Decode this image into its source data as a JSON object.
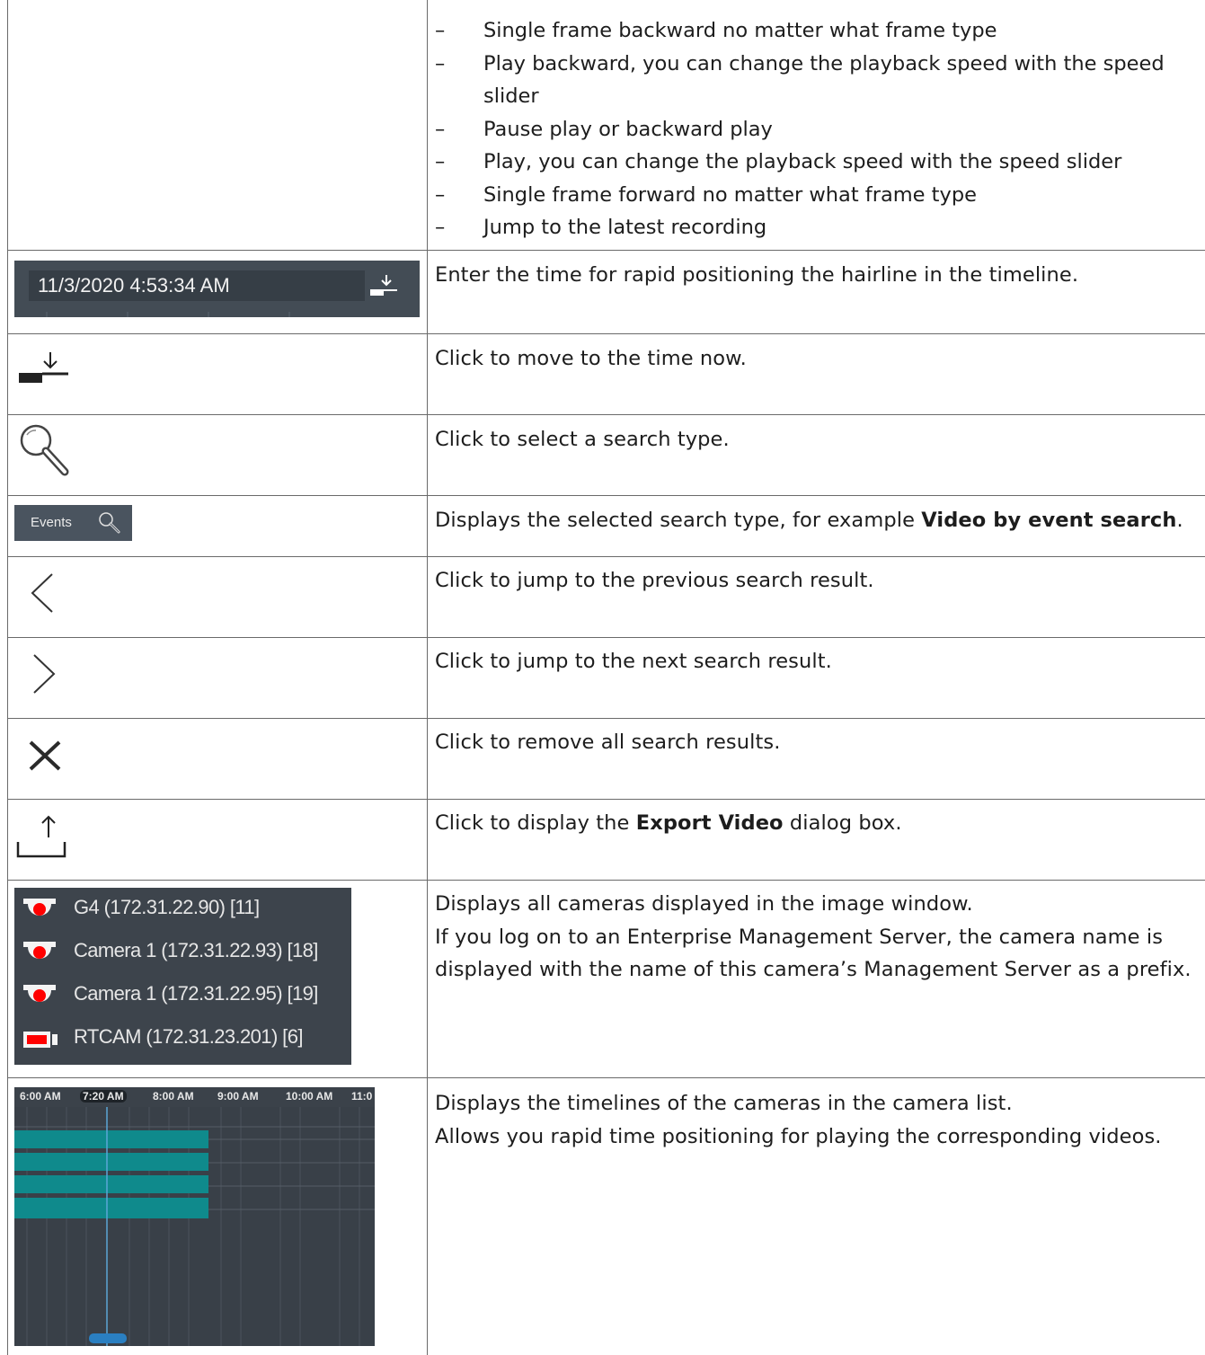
{
  "playback_list": [
    "Single frame backward no matter what frame type",
    "Play backward, you can change the playback speed with the speed slider",
    "Pause play or backward play",
    "Play, you can change the playback speed with the speed slider",
    "Single frame forward no matter what frame type",
    "Jump to the latest recording"
  ],
  "bullet_dash": "–",
  "rows": {
    "time_field": {
      "value": "11/3/2020 4:53:34 AM",
      "description": "Enter the time for rapid positioning the hairline in the timeline."
    },
    "time_now": {
      "icon": "move-to-now-icon",
      "description": "Click to move to the time now."
    },
    "search_type": {
      "icon": "magnifier-icon",
      "description": "Click to select a search type."
    },
    "events": {
      "label": "Events",
      "description_pre": "Displays the selected search type, for example ",
      "description_bold": "Video by event search",
      "description_post": "."
    },
    "previous": {
      "icon": "chevron-left-icon",
      "description": "Click to jump to the previous search result."
    },
    "next": {
      "icon": "chevron-right-icon",
      "description": "Click to jump to the next search result."
    },
    "remove": {
      "icon": "close-icon",
      "description": "Click to remove all search results."
    },
    "export": {
      "icon": "export-icon",
      "description_pre": "Click to display the ",
      "description_bold": "Export Video",
      "description_post": " dialog box."
    },
    "camera_list": {
      "cameras": [
        {
          "name": "G4 (172.31.22.90) [11]",
          "icon": "dome-camera-icon"
        },
        {
          "name": "Camera 1 (172.31.22.93) [18]",
          "icon": "dome-camera-icon"
        },
        {
          "name": "Camera 1 (172.31.22.95) [19]",
          "icon": "dome-camera-icon"
        },
        {
          "name": "RTCAM (172.31.23.201) [6]",
          "icon": "box-camera-icon"
        }
      ],
      "description_1": "Displays all cameras displayed in the image window.",
      "description_2": "If you log on to an Enterprise Management Server, the camera name is displayed with the name of this camera’s Management Server as a prefix."
    },
    "timeline": {
      "labels": [
        "6:00 AM",
        "7:20 AM",
        "8:00 AM",
        "9:00 AM",
        "10:00 AM",
        "11:0"
      ],
      "selected_label": "7:20 AM",
      "description_1": "Displays the timelines of the cameras in the camera list.",
      "description_2": "Allows you rapid time positioning for playing the corresponding videos."
    }
  },
  "colors": {
    "recording": "#0f8a8c",
    "hairline": "#5aa6d6",
    "camera_red": "#ff0000"
  }
}
